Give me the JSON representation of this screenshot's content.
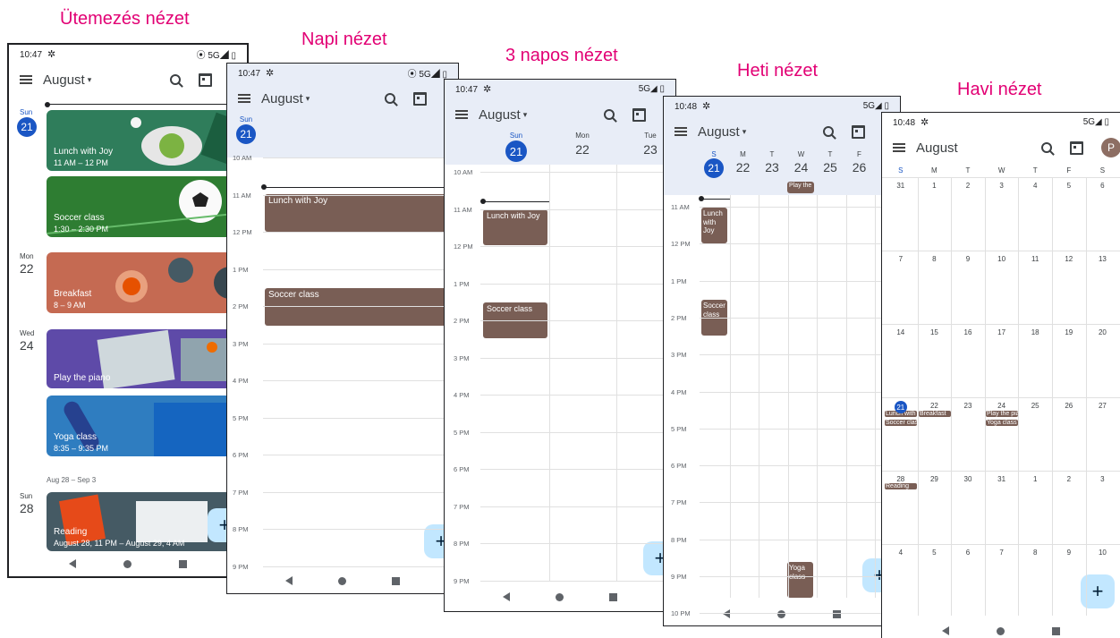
{
  "captions": {
    "schedule": "Ütemezés nézet",
    "day": "Napi nézet",
    "three_day": "3 napos nézet",
    "week": "Heti nézet",
    "month": "Havi nézet"
  },
  "status": {
    "time1": "10:47",
    "time2": "10:48",
    "signal": "5G◢",
    "loc": "⦿"
  },
  "toolbar": {
    "month_caret": "August",
    "month_plain": "August",
    "caret": "▾",
    "avatar": "P"
  },
  "fab": "+",
  "schedule": {
    "d21_lbl": "Sun",
    "d21_num": "21",
    "d22_lbl": "Mon",
    "d22_num": "22",
    "d24_lbl": "Wed",
    "d24_num": "24",
    "range": "Aug 28 – Sep 3",
    "d28_lbl": "Sun",
    "d28_num": "28",
    "cards": [
      {
        "title": "Lunch with Joy",
        "time": "11 AM – 12 PM"
      },
      {
        "title": "Soccer class",
        "time": "1:30 – 2:30 PM"
      },
      {
        "title": "Breakfast",
        "time": "8 – 9 AM"
      },
      {
        "title": "Play the piano",
        "time": ""
      },
      {
        "title": "Yoga class",
        "time": "8:35 – 9:35 PM"
      },
      {
        "title": "Reading",
        "time": "August 28, 11 PM – August 29, 4 AM"
      }
    ]
  },
  "day": {
    "dlbl": "Sun",
    "dnum": "21",
    "hours": [
      "10 AM",
      "11 AM",
      "12 PM",
      "1 PM",
      "2 PM",
      "3 PM",
      "4 PM",
      "5 PM",
      "6 PM",
      "7 PM",
      "8 PM",
      "9 PM"
    ],
    "ev1": "Lunch with Joy",
    "ev2": "Soccer class"
  },
  "three": {
    "days": [
      {
        "lbl": "Sun",
        "num": "21"
      },
      {
        "lbl": "Mon",
        "num": "22"
      },
      {
        "lbl": "Tue",
        "num": "23"
      }
    ],
    "hours": [
      "10 AM",
      "11 AM",
      "12 PM",
      "1 PM",
      "2 PM",
      "3 PM",
      "4 PM",
      "5 PM",
      "6 PM",
      "7 PM",
      "8 PM",
      "9 PM"
    ],
    "ev1": "Lunch with Joy",
    "ev2": "Soccer class"
  },
  "week": {
    "days": [
      {
        "lbl": "S",
        "num": "21"
      },
      {
        "lbl": "M",
        "num": "22"
      },
      {
        "lbl": "T",
        "num": "23"
      },
      {
        "lbl": "W",
        "num": "24"
      },
      {
        "lbl": "T",
        "num": "25"
      },
      {
        "lbl": "F",
        "num": "26"
      }
    ],
    "allday": "Play the",
    "hours": [
      "11 AM",
      "12 PM",
      "1 PM",
      "2 PM",
      "3 PM",
      "4 PM",
      "5 PM",
      "6 PM",
      "7 PM",
      "8 PM",
      "9 PM",
      "10 PM"
    ],
    "ev1": "Lunch with Joy",
    "ev2": "Soccer class",
    "ev3": "Yoga class"
  },
  "month": {
    "dow": [
      "S",
      "M",
      "T",
      "W",
      "T",
      "F",
      "S"
    ],
    "rows": [
      [
        "31",
        "1",
        "2",
        "3",
        "4",
        "5",
        "6"
      ],
      [
        "7",
        "8",
        "9",
        "10",
        "11",
        "12",
        "13"
      ],
      [
        "14",
        "15",
        "16",
        "17",
        "18",
        "19",
        "20"
      ],
      [
        "21",
        "22",
        "23",
        "24",
        "25",
        "26",
        "27"
      ],
      [
        "28",
        "29",
        "30",
        "31",
        "1",
        "2",
        "3"
      ],
      [
        "4",
        "5",
        "6",
        "7",
        "8",
        "9",
        "10"
      ]
    ],
    "ev_lunch": "Lunch with Joy",
    "ev_soccer": "Soccer class",
    "ev_breakfast": "Breakfast",
    "ev_piano": "Play the piano",
    "ev_yoga": "Yoga class",
    "ev_reading": "Reading"
  },
  "colors": {
    "accent": "#e20074",
    "today": "#1a56c4",
    "event": "#795e55",
    "header": "#e8edf7",
    "fab": "#c2e7ff"
  }
}
